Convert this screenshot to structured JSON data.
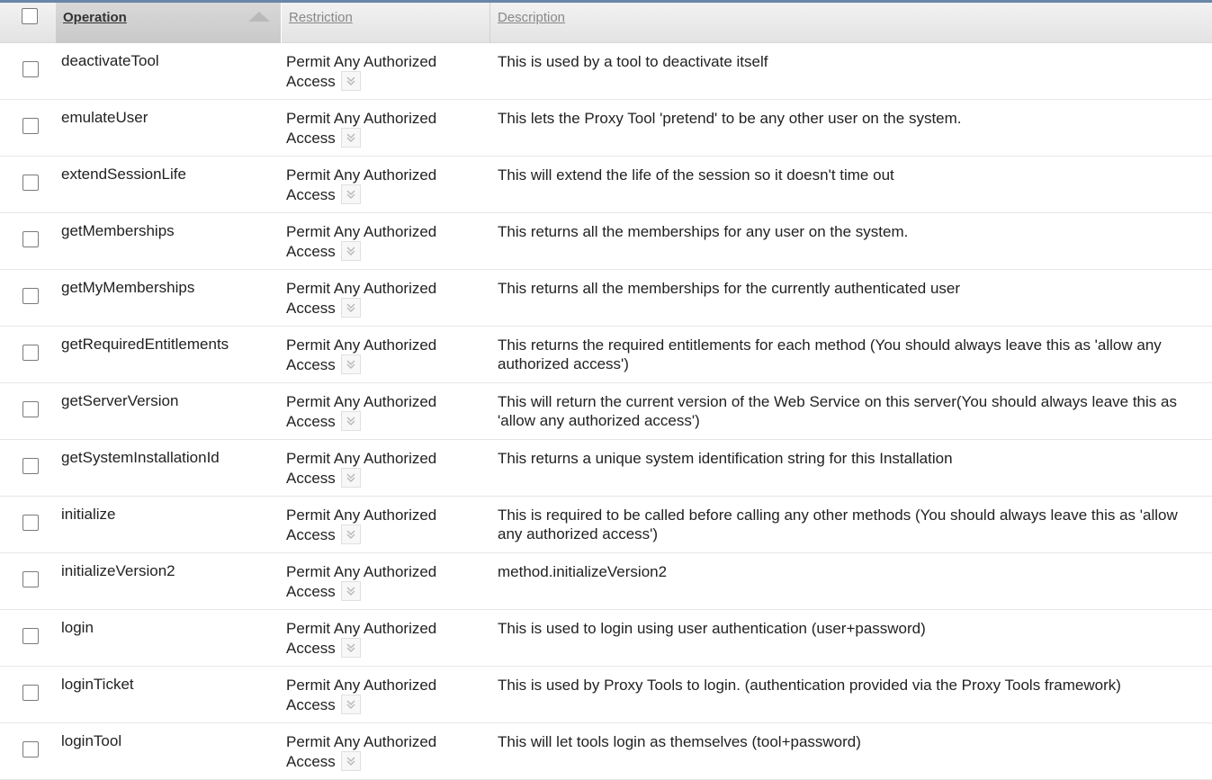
{
  "header": {
    "operation": "Operation",
    "restriction": "Restriction",
    "description": "Description"
  },
  "rows": [
    {
      "operation": "deactivateTool",
      "restriction_l1": "Permit Any Authorized",
      "restriction_l2": "Access",
      "description": "This is used by a tool to deactivate itself"
    },
    {
      "operation": "emulateUser",
      "restriction_l1": "Permit Any Authorized",
      "restriction_l2": "Access",
      "description": "This lets the Proxy Tool 'pretend' to be any other user on the system."
    },
    {
      "operation": "extendSessionLife",
      "restriction_l1": "Permit Any Authorized",
      "restriction_l2": "Access",
      "description": "This will extend the life of the session so it doesn't time out"
    },
    {
      "operation": "getMemberships",
      "restriction_l1": "Permit Any Authorized",
      "restriction_l2": "Access",
      "description": "This returns all the memberships for any user on the system."
    },
    {
      "operation": "getMyMemberships",
      "restriction_l1": "Permit Any Authorized",
      "restriction_l2": "Access",
      "description": "This returns all the memberships for the currently authenticated user"
    },
    {
      "operation": "getRequiredEntitlements",
      "restriction_l1": "Permit Any Authorized",
      "restriction_l2": "Access",
      "description": "This returns the required entitlements for each method (You should always leave this as 'allow any authorized access')"
    },
    {
      "operation": "getServerVersion",
      "restriction_l1": "Permit Any Authorized",
      "restriction_l2": "Access",
      "description": "This will return the current version of the Web Service on this server(You should always leave this as 'allow any authorized access')"
    },
    {
      "operation": "getSystemInstallationId",
      "restriction_l1": "Permit Any Authorized",
      "restriction_l2": "Access",
      "description": "This returns a unique system identification string for this Installation"
    },
    {
      "operation": "initialize",
      "restriction_l1": "Permit Any Authorized",
      "restriction_l2": "Access",
      "description": "This is required to be called before calling any other methods (You should always leave this as 'allow any authorized access')"
    },
    {
      "operation": "initializeVersion2",
      "restriction_l1": "Permit Any Authorized",
      "restriction_l2": "Access",
      "description": "method.initializeVersion2"
    },
    {
      "operation": "login",
      "restriction_l1": "Permit Any Authorized",
      "restriction_l2": "Access",
      "description": "This is used to login using user authentication (user+password)"
    },
    {
      "operation": "loginTicket",
      "restriction_l1": "Permit Any Authorized",
      "restriction_l2": "Access",
      "description": "This is used by Proxy Tools to login. (authentication provided via the Proxy Tools framework)"
    },
    {
      "operation": "loginTool",
      "restriction_l1": "Permit Any Authorized",
      "restriction_l2": "Access",
      "description": "This will let tools login as themselves (tool+password)"
    }
  ]
}
